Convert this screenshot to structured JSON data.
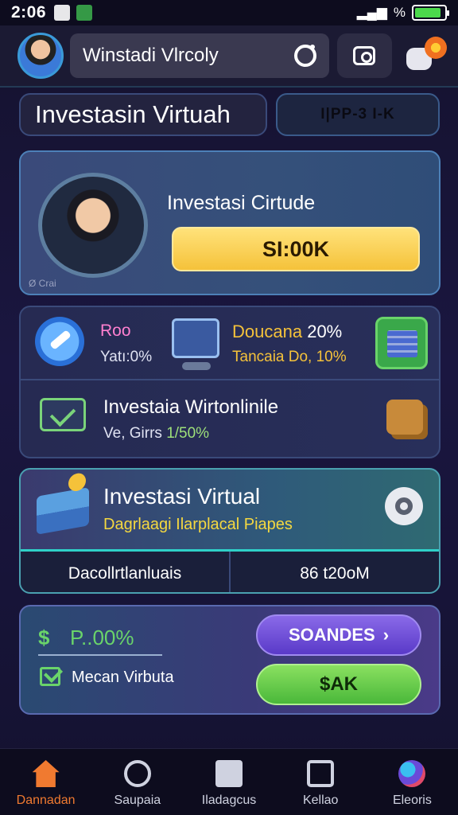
{
  "status_bar": {
    "time": "2:06",
    "battery_text": "%",
    "battery_level": 0.9
  },
  "header": {
    "search_text": "Winstadi Vlrcoly"
  },
  "tabs": {
    "title": "Investasin Virtuah",
    "tag": "I|PP-3 I-K"
  },
  "hero": {
    "title": "Investasi Cirtude",
    "amount": "SI:00K",
    "caption": "Ø Crai"
  },
  "stats": {
    "a_label": "Roo",
    "a_sub": "Yatı:0%",
    "b_label": "Doucana",
    "b_value": "20%",
    "b_sub": "Tancaia Do, 10%",
    "row2_title": "Investaia Wirtonlinile",
    "row2_sub": "Ve, Girrs",
    "row2_sub_highlight": "1/50%"
  },
  "panel": {
    "title": "Investasi Virtual",
    "subtitle": "Dagrlaagi Ilarplacal Piapes",
    "cell_left": "Dacollrtlanluais",
    "cell_right": "86 t20oM"
  },
  "action": {
    "rate_symbol": "$",
    "rate_text": "P..00%",
    "meta_text": "Mecan Virbuta",
    "primary_button": "SOANDES",
    "primary_arrow": "›",
    "secondary_button": "$AK"
  },
  "bottom_nav": [
    {
      "label": "Dannadan",
      "icon": "home-icon",
      "active": true
    },
    {
      "label": "Saupaia",
      "icon": "profile-icon",
      "active": false
    },
    {
      "label": "Iladagcus",
      "icon": "task-icon",
      "active": false
    },
    {
      "label": "Kellao",
      "icon": "tv-icon",
      "active": false
    },
    {
      "label": "Eleoris",
      "icon": "globe-icon",
      "active": false
    }
  ],
  "colors": {
    "accent_gold": "#f5c23a",
    "accent_green": "#6ad46a",
    "accent_purple": "#6a4ad8",
    "accent_orange": "#f07a30",
    "background": "#15122e"
  }
}
